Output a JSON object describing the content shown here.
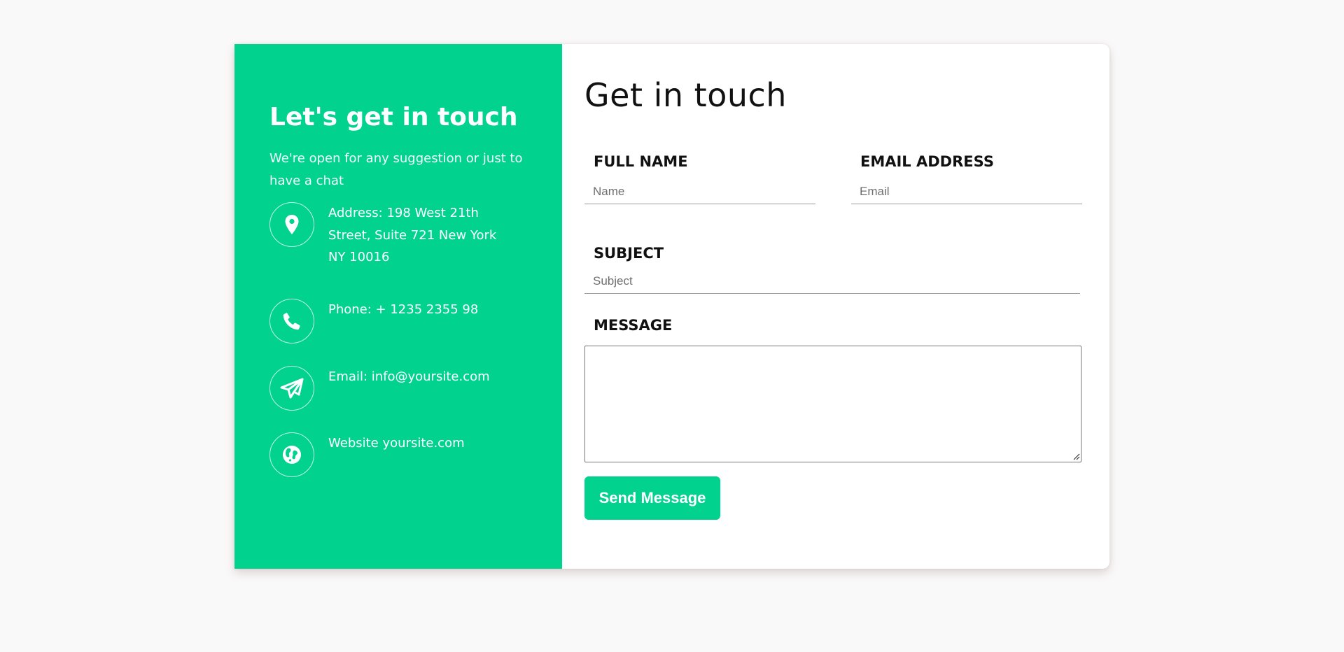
{
  "info": {
    "title": "Let's get in touch",
    "subtitle": "We're open for any suggestion or just to have a chat",
    "items": [
      {
        "icon": "map-pin-icon",
        "text": "Address: 198 West 21th Street, Suite 721 New York NY 10016"
      },
      {
        "icon": "phone-icon",
        "text": "Phone: + 1235 2355 98"
      },
      {
        "icon": "paper-plane-icon",
        "text": "Email: info@yoursite.com"
      },
      {
        "icon": "globe-icon",
        "text": "Website yoursite.com"
      }
    ]
  },
  "form": {
    "title": "Get in touch",
    "full_name_label": "FULL NAME",
    "full_name_placeholder": "Name",
    "email_label": "EMAIL ADDRESS",
    "email_placeholder": "Email",
    "subject_label": "SUBJECT",
    "subject_placeholder": "Subject",
    "message_label": "MESSAGE",
    "message_value": "",
    "send_label": "Send Message"
  },
  "colors": {
    "accent": "#01d28e",
    "background": "#faf9f9",
    "card": "#ffffff"
  }
}
